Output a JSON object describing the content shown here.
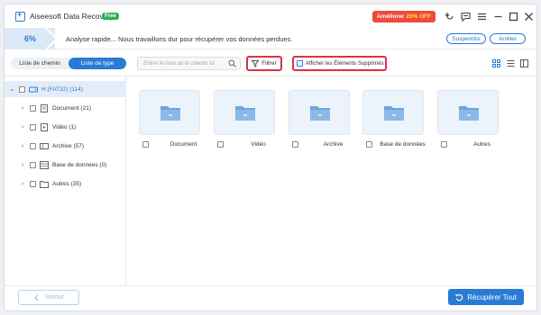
{
  "app": {
    "title": "Aiseesoft Data Recovery",
    "badge": "Free",
    "upgrade_label": "Améliorer",
    "upgrade_discount": "20% OFF"
  },
  "scan": {
    "progress_text": "6%",
    "progress_fraction": 0.06,
    "status_text": "Analyse rapide... Nous travaillons dur pour récupérer vos données perdues.",
    "pause_label": "Suspendre",
    "stop_label": "Arrêter"
  },
  "toolbar": {
    "tab_path": "Liste de chemin",
    "tab_type": "Liste de type",
    "search_placeholder": "Entrer le nom ou le chemin ici",
    "filter_label": "Filtrer",
    "show_deleted_label": "Afficher les Éléments Supprimés"
  },
  "tree": {
    "root": "H:(FAT32) (114)",
    "items": [
      {
        "label": "Document (21)",
        "icon": "document-icon"
      },
      {
        "label": "Vidéo (1)",
        "icon": "video-icon"
      },
      {
        "label": "Archive (57)",
        "icon": "archive-icon"
      },
      {
        "label": "Base de données (0)",
        "icon": "database-icon"
      },
      {
        "label": "Autres (35)",
        "icon": "folder-icon"
      }
    ]
  },
  "grid": {
    "items": [
      {
        "label": "Document"
      },
      {
        "label": "Vidéo"
      },
      {
        "label": "Archive"
      },
      {
        "label": "Base de données"
      },
      {
        "label": "Autres"
      }
    ]
  },
  "footer": {
    "back_label": "Retour",
    "recover_label": "Récupérer Tout"
  },
  "colors": {
    "accent": "#2a7bd6",
    "highlight_border": "#d9334a",
    "upgrade_bg": "#ef4a3a",
    "free_badge": "#2ab056"
  }
}
